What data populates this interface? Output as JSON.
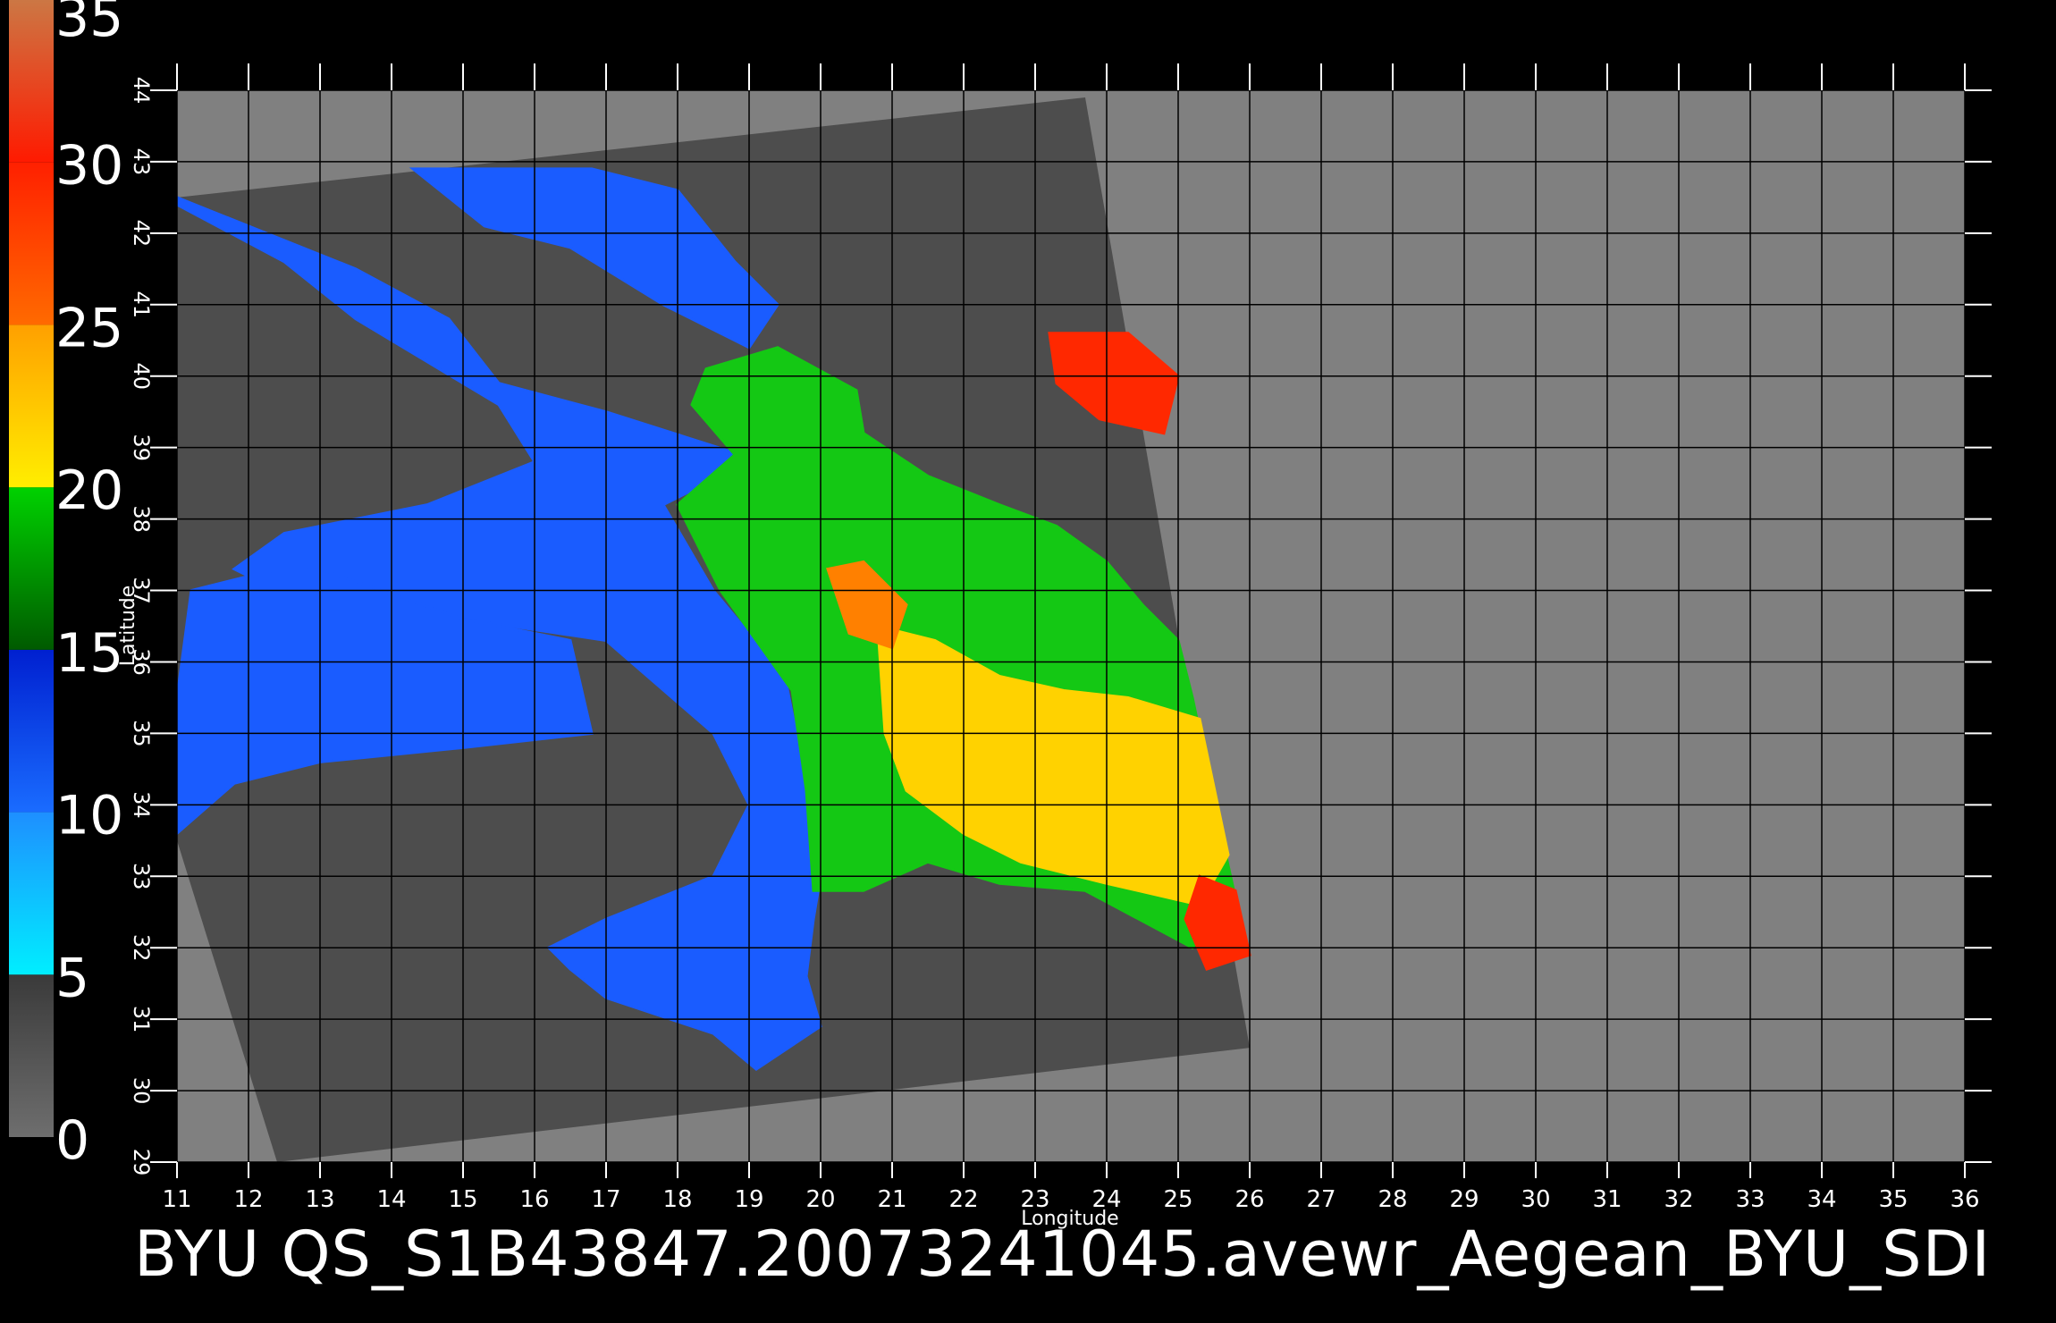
{
  "caption": "BYU  QS_S1B43847.20073241045.avewr_Aegean_BYU_SDI",
  "colors": {
    "background": "#000000",
    "frame": "#808080",
    "swath": "#4d4d4d",
    "grid": "#000000",
    "land_note": "gray where no data"
  },
  "colorbar": {
    "labels": [
      "0",
      "5",
      "10",
      "15",
      "20",
      "25",
      "30",
      "35"
    ],
    "value_min": 0,
    "value_max": 35,
    "bands": [
      {
        "from": 0,
        "to": 5,
        "colors": [
          "#6e6e6e",
          "#3a3a3a"
        ]
      },
      {
        "from": 5,
        "to": 10,
        "colors": [
          "#00eeff",
          "#1e8fff"
        ]
      },
      {
        "from": 10,
        "to": 15,
        "colors": [
          "#1a6cff",
          "#0020d0"
        ]
      },
      {
        "from": 15,
        "to": 20,
        "colors": [
          "#005a00",
          "#00d200"
        ]
      },
      {
        "from": 20,
        "to": 25,
        "colors": [
          "#ffee00",
          "#ffa000"
        ]
      },
      {
        "from": 25,
        "to": 30,
        "colors": [
          "#ff6a00",
          "#ff2000"
        ]
      },
      {
        "from": 30,
        "to": 35,
        "colors": [
          "#ff1a00",
          "#cc7744"
        ]
      }
    ]
  },
  "map": {
    "xlabel": "Longitude",
    "ylabel": "Latitude",
    "lon_range": [
      11,
      36
    ],
    "lat_range": [
      29,
      44
    ],
    "lon_ticks": [
      "11",
      "12",
      "13",
      "14",
      "15",
      "16",
      "17",
      "18",
      "19",
      "20",
      "21",
      "22",
      "23",
      "24",
      "25",
      "26",
      "27",
      "28",
      "29",
      "30",
      "31",
      "32",
      "33",
      "34",
      "35",
      "36"
    ],
    "lat_ticks": [
      "29",
      "30",
      "31",
      "32",
      "33",
      "34",
      "35",
      "36",
      "37",
      "38",
      "39",
      "40",
      "41",
      "42",
      "43",
      "44"
    ],
    "grid": true,
    "swath_corners_lonlat": [
      [
        11.0,
        42.5
      ],
      [
        23.7,
        43.9
      ],
      [
        26.0,
        30.6
      ],
      [
        12.4,
        29.0
      ],
      [
        11.0,
        33.5
      ]
    ],
    "wind_speed_regions": [
      {
        "name": "western-sea",
        "speed_band": "10-15",
        "color": "#1a5cff",
        "outline_lonlat": [
          [
            11.0,
            42.4
          ],
          [
            12.5,
            41.6
          ],
          [
            13.5,
            40.8
          ],
          [
            14.5,
            40.2
          ],
          [
            15.5,
            39.6
          ],
          [
            16.0,
            38.8
          ],
          [
            14.5,
            38.2
          ],
          [
            12.5,
            37.8
          ],
          [
            11.8,
            37.3
          ],
          [
            12.8,
            36.8
          ],
          [
            15.0,
            36.6
          ],
          [
            17.0,
            36.3
          ],
          [
            18.5,
            35.0
          ],
          [
            19.0,
            34.0
          ],
          [
            18.5,
            33.0
          ],
          [
            17.0,
            32.4
          ],
          [
            16.2,
            32.0
          ],
          [
            16.5,
            31.7
          ],
          [
            17.0,
            31.3
          ],
          [
            18.5,
            30.8
          ],
          [
            19.1,
            30.3
          ],
          [
            20.0,
            30.9
          ],
          [
            19.8,
            31.6
          ],
          [
            19.9,
            32.4
          ],
          [
            20.0,
            33.0
          ],
          [
            19.8,
            34.3
          ],
          [
            19.5,
            35.8
          ],
          [
            18.5,
            37.0
          ],
          [
            17.8,
            38.2
          ],
          [
            18.4,
            38.5
          ],
          [
            19.2,
            38.8
          ],
          [
            17.0,
            39.5
          ],
          [
            15.5,
            39.9
          ],
          [
            14.8,
            40.8
          ],
          [
            13.5,
            41.5
          ],
          [
            11.0,
            42.5
          ]
        ]
      },
      {
        "name": "adriatic",
        "speed_band": "10-15",
        "color": "#1a5cff",
        "outline_lonlat": [
          [
            14.3,
            42.9
          ],
          [
            16.8,
            42.9
          ],
          [
            18.0,
            42.6
          ],
          [
            18.8,
            41.6
          ],
          [
            19.4,
            41.0
          ],
          [
            19.0,
            40.4
          ],
          [
            17.8,
            41.0
          ],
          [
            16.5,
            41.8
          ],
          [
            15.3,
            42.1
          ],
          [
            14.3,
            42.9
          ]
        ]
      },
      {
        "name": "ionian-green",
        "speed_band": "15-20",
        "color": "#14c814",
        "outline_lonlat": [
          [
            18.4,
            40.1
          ],
          [
            19.4,
            40.4
          ],
          [
            20.5,
            39.8
          ],
          [
            20.6,
            39.2
          ],
          [
            21.5,
            38.6
          ],
          [
            22.5,
            38.2
          ],
          [
            23.3,
            37.9
          ],
          [
            24.0,
            37.4
          ],
          [
            24.5,
            36.8
          ],
          [
            25.0,
            36.3
          ],
          [
            25.2,
            35.5
          ],
          [
            25.6,
            33.6
          ],
          [
            25.8,
            32.7
          ],
          [
            25.2,
            32.0
          ],
          [
            23.7,
            32.8
          ],
          [
            22.5,
            32.9
          ],
          [
            21.5,
            33.2
          ],
          [
            20.6,
            32.8
          ],
          [
            19.9,
            32.8
          ],
          [
            19.8,
            34.2
          ],
          [
            19.6,
            35.6
          ],
          [
            18.6,
            37.0
          ],
          [
            18.0,
            38.2
          ],
          [
            18.8,
            38.9
          ],
          [
            18.2,
            39.6
          ],
          [
            18.4,
            40.1
          ]
        ]
      },
      {
        "name": "aegean-yellow",
        "speed_band": "20-25",
        "color": "#ffd200",
        "outline_lonlat": [
          [
            20.8,
            36.5
          ],
          [
            21.6,
            36.3
          ],
          [
            22.5,
            35.8
          ],
          [
            23.4,
            35.6
          ],
          [
            24.3,
            35.5
          ],
          [
            25.3,
            35.2
          ],
          [
            25.7,
            33.3
          ],
          [
            25.3,
            32.6
          ],
          [
            24.0,
            32.9
          ],
          [
            22.8,
            33.2
          ],
          [
            22.0,
            33.6
          ],
          [
            21.2,
            34.2
          ],
          [
            20.9,
            35.0
          ],
          [
            20.8,
            36.5
          ]
        ]
      },
      {
        "name": "crete-orange",
        "speed_band": "25-30",
        "color": "#ff8000",
        "outline_lonlat": [
          [
            20.1,
            37.3
          ],
          [
            20.6,
            37.4
          ],
          [
            21.2,
            36.8
          ],
          [
            21.0,
            36.2
          ],
          [
            20.4,
            36.4
          ],
          [
            20.1,
            37.3
          ]
        ]
      },
      {
        "name": "red-southeast",
        "speed_band": "30-35",
        "color": "#ff2800",
        "outline_lonlat": [
          [
            25.3,
            33.0
          ],
          [
            25.8,
            32.8
          ],
          [
            26.0,
            31.9
          ],
          [
            25.4,
            31.7
          ],
          [
            25.1,
            32.4
          ],
          [
            25.3,
            33.0
          ]
        ]
      },
      {
        "name": "red-northeast",
        "speed_band": "30-35",
        "color": "#ff2800",
        "outline_lonlat": [
          [
            23.2,
            40.6
          ],
          [
            24.3,
            40.6
          ],
          [
            25.0,
            40.0
          ],
          [
            24.8,
            39.2
          ],
          [
            23.9,
            39.4
          ],
          [
            23.3,
            39.9
          ],
          [
            23.2,
            40.6
          ]
        ]
      },
      {
        "name": "tyrrhenian-south",
        "speed_band": "10-15",
        "color": "#1a5cff",
        "outline_lonlat": [
          [
            11.2,
            37.0
          ],
          [
            12.0,
            37.2
          ],
          [
            13.0,
            37.3
          ],
          [
            15.0,
            36.6
          ],
          [
            16.5,
            36.3
          ],
          [
            16.8,
            35.0
          ],
          [
            15.0,
            34.8
          ],
          [
            13.0,
            34.6
          ],
          [
            11.8,
            34.3
          ],
          [
            11.0,
            33.6
          ],
          [
            11.0,
            35.5
          ],
          [
            11.2,
            37.0
          ]
        ]
      }
    ]
  }
}
